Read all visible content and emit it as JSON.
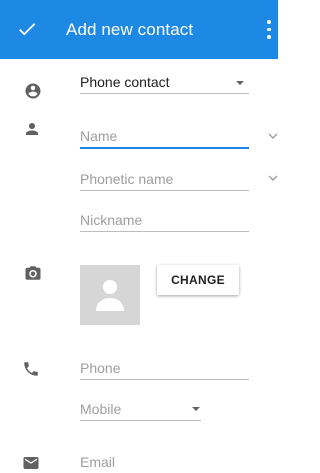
{
  "appbar": {
    "title": "Add new contact",
    "check_icon": "check-icon",
    "menu_icon": "more-vert-icon",
    "color": "#1e88e5"
  },
  "account": {
    "selected": "Phone contact",
    "icon": "account-circle-icon"
  },
  "name_section": {
    "icon": "person-icon",
    "name_placeholder": "Name",
    "phonetic_placeholder": "Phonetic name",
    "nickname_placeholder": "Nickname"
  },
  "photo": {
    "icon": "camera-icon",
    "change_label": "CHANGE"
  },
  "phone": {
    "icon": "phone-icon",
    "placeholder": "Phone",
    "type": "Mobile"
  },
  "email": {
    "icon": "email-icon",
    "placeholder": "Email"
  },
  "accent": "#1e88e5"
}
